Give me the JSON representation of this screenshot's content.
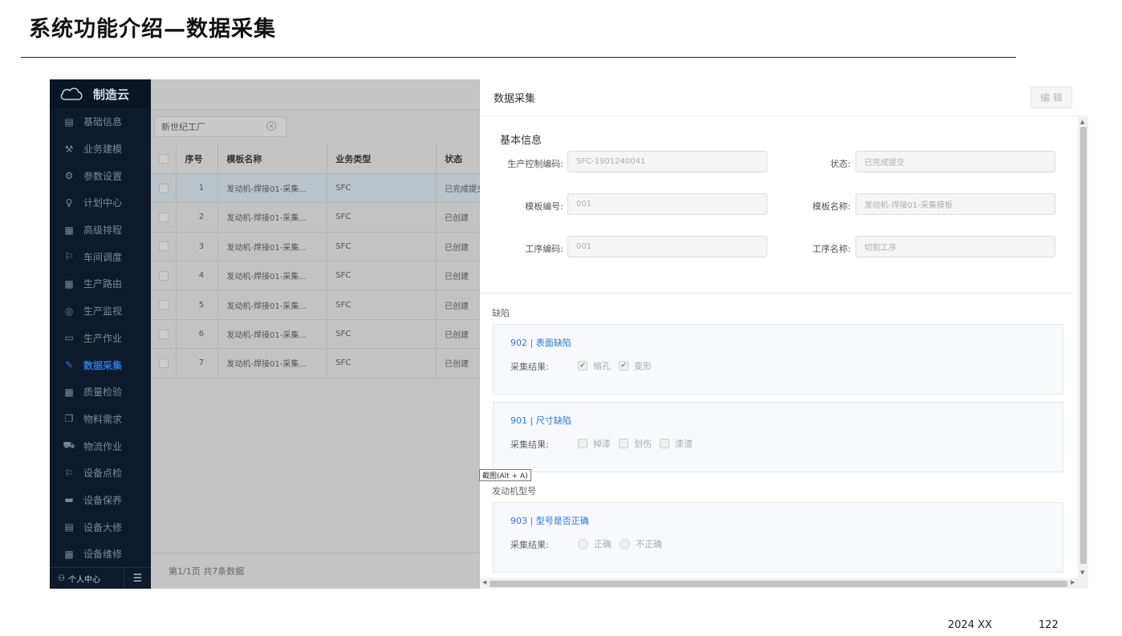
{
  "slide": {
    "title": "系统功能介绍—数据采集",
    "footer_date": "2024 XX",
    "page_number": "122"
  },
  "app": {
    "brand": "制造云",
    "sidebar": {
      "items": [
        {
          "label": "基础信息",
          "icon": "document-icon"
        },
        {
          "label": "业务建模",
          "icon": "wrench-icon"
        },
        {
          "label": "参数设置",
          "icon": "gear-icon"
        },
        {
          "label": "计划中心",
          "icon": "bulb-icon"
        },
        {
          "label": "高级排程",
          "icon": "grid-icon"
        },
        {
          "label": "车间调度",
          "icon": "flag-icon"
        },
        {
          "label": "生产路由",
          "icon": "grid-icon"
        },
        {
          "label": "生产监视",
          "icon": "location-icon"
        },
        {
          "label": "生产作业",
          "icon": "folder-icon"
        },
        {
          "label": "数据采集",
          "icon": "pen-icon",
          "active": true
        },
        {
          "label": "质量检验",
          "icon": "grid-icon"
        },
        {
          "label": "物料需求",
          "icon": "copy-icon"
        },
        {
          "label": "物流作业",
          "icon": "car-icon"
        },
        {
          "label": "设备点检",
          "icon": "flag-icon"
        },
        {
          "label": "设备保养",
          "icon": "card-icon"
        },
        {
          "label": "设备大修",
          "icon": "document-icon"
        },
        {
          "label": "设备维修",
          "icon": "grid-icon"
        }
      ],
      "user_center": "个人中心",
      "colors": {
        "background": "#0c1a2c",
        "active": "#2a79d8"
      }
    },
    "list": {
      "factory": "新世纪工厂",
      "columns": [
        "序号",
        "模板名称",
        "业务类型",
        "状态"
      ],
      "rows": [
        {
          "no": "1",
          "name": "发动机-焊接01-采集...",
          "type": "SFC",
          "status": "已完成提交",
          "selected": true
        },
        {
          "no": "2",
          "name": "发动机-焊接01-采集...",
          "type": "SFC",
          "status": "已创建"
        },
        {
          "no": "3",
          "name": "发动机-焊接01-采集...",
          "type": "SFC",
          "status": "已创建"
        },
        {
          "no": "4",
          "name": "发动机-焊接01-采集...",
          "type": "SFC",
          "status": "已创建"
        },
        {
          "no": "5",
          "name": "发动机-焊接01-采集...",
          "type": "SFC",
          "status": "已创建"
        },
        {
          "no": "6",
          "name": "发动机-焊接01-采集...",
          "type": "SFC",
          "status": "已创建"
        },
        {
          "no": "7",
          "name": "发动机-焊接01-采集...",
          "type": "SFC",
          "status": "已创建"
        }
      ],
      "pagination": "第1/1页   共7条数据"
    },
    "detail": {
      "title": "数据采集",
      "edit_label": "编 辑",
      "basic_title": "基本信息",
      "fields": {
        "sfc_code": {
          "label": "生产控制编码:",
          "value": "SFC-1901240041"
        },
        "status": {
          "label": "状态:",
          "value": "已完成提交"
        },
        "template_code": {
          "label": "模板编号:",
          "value": "001"
        },
        "template_name": {
          "label": "模板名称:",
          "value": "发动机-焊接01-采集模板"
        },
        "process_code": {
          "label": "工序编码:",
          "value": "001"
        },
        "process_name": {
          "label": "工序名称:",
          "value": "切割工序"
        }
      },
      "group_defects": "缺陷",
      "group_model": "发动机型号",
      "result_label": "采集结果:",
      "cards": [
        {
          "name": "902 | 表面缺陷",
          "kind": "checkbox",
          "options": [
            {
              "label": "缩孔",
              "checked": true
            },
            {
              "label": "变形",
              "checked": true
            }
          ]
        },
        {
          "name": "901 | 尺寸缺陷",
          "kind": "checkbox",
          "options": [
            {
              "label": "掉漆",
              "checked": false
            },
            {
              "label": "划伤",
              "checked": false
            },
            {
              "label": "漆渣",
              "checked": false
            }
          ]
        },
        {
          "name": "903 | 型号是否正确",
          "kind": "radio",
          "options": [
            {
              "label": "正确",
              "checked": false
            },
            {
              "label": "不正确",
              "checked": false
            }
          ]
        }
      ],
      "link_color": "#2a79d8"
    },
    "tooltip": "截图(Alt + A)"
  }
}
